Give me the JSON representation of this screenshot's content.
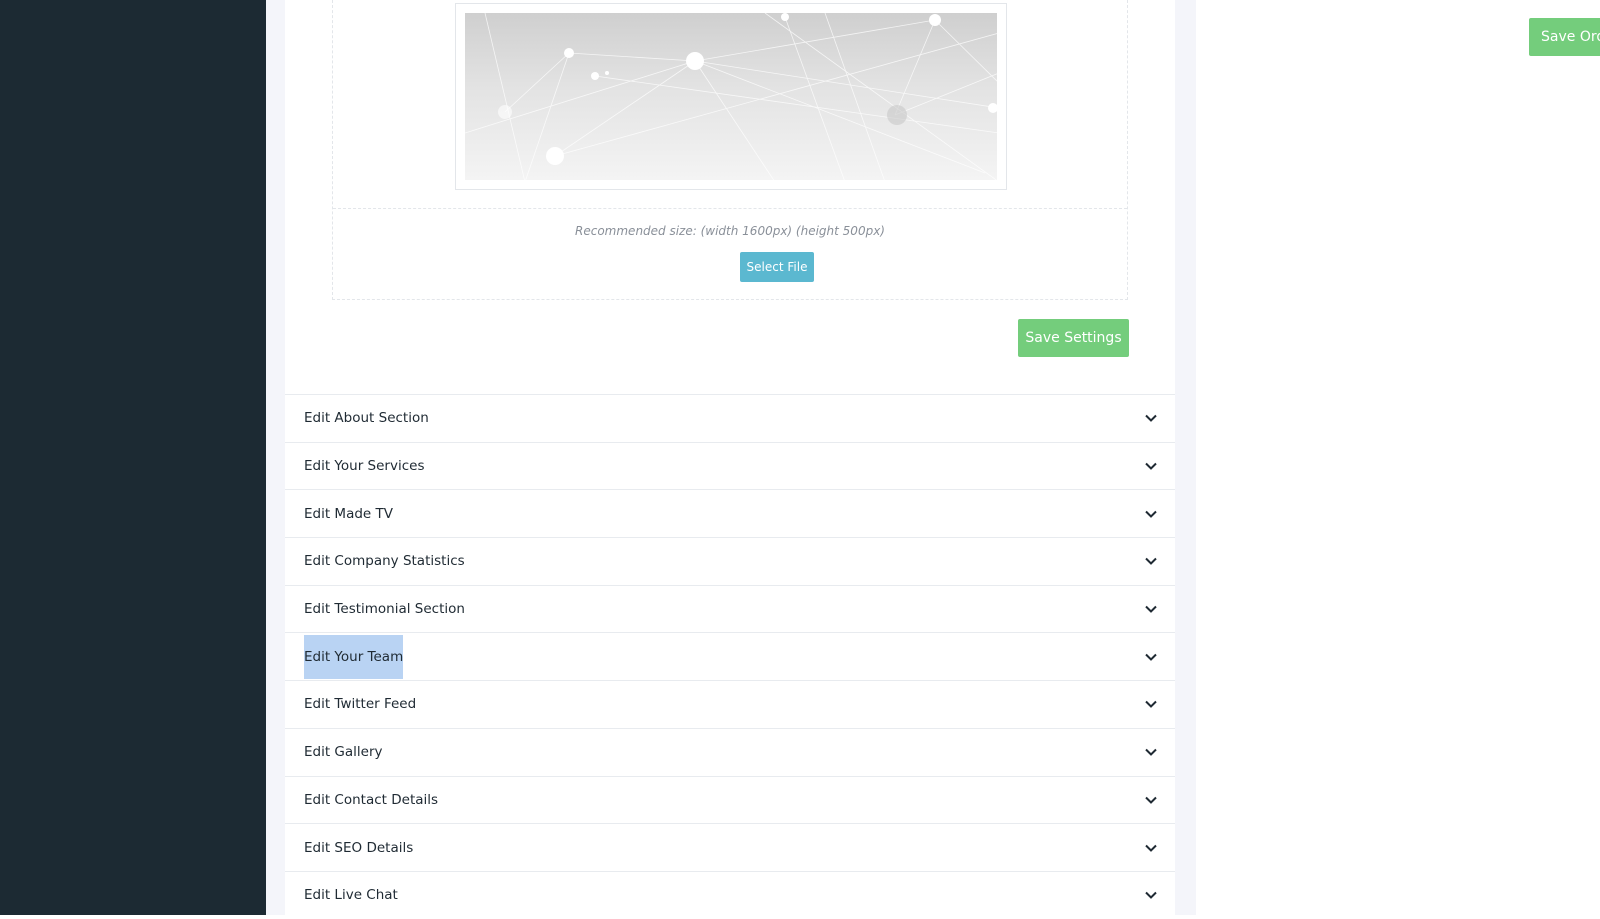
{
  "upload": {
    "recommended_size": "Recommended size: (width 1600px) (height 500px)",
    "select_file_label": "Select File"
  },
  "save_settings_label": "Save Settings",
  "save_order_label": "Save Orde",
  "accordion": {
    "items": [
      {
        "label": "Edit About Section"
      },
      {
        "label": "Edit Your Services"
      },
      {
        "label": "Edit Made TV"
      },
      {
        "label": "Edit Company Statistics"
      },
      {
        "label": "Edit Testimonial Section"
      },
      {
        "label": "Edit Your Team",
        "selected": true
      },
      {
        "label": "Edit Twitter Feed"
      },
      {
        "label": "Edit Gallery"
      },
      {
        "label": "Edit Contact Details"
      },
      {
        "label": "Edit SEO Details"
      },
      {
        "label": "Edit Live Chat"
      }
    ]
  },
  "colors": {
    "sidebar": "#1c2a33",
    "accent_green": "#74cd7c",
    "select_file_blue": "#5bb8d0",
    "selection_highlight": "#b9d3f3"
  }
}
